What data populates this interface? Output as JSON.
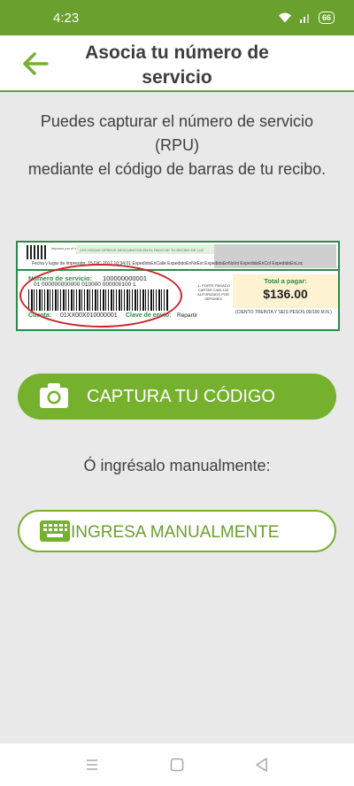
{
  "status_bar": {
    "time": "4:23",
    "battery": "66",
    "icons": [
      "wifi-icon",
      "signal-icon",
      "battery-icon"
    ]
  },
  "header": {
    "title": "Asocia tu número de servicio",
    "back_icon": "arrow-left-icon"
  },
  "instruction": {
    "line1": "Puedes capturar el número de servicio (RPU)",
    "line2": "mediante el código de barras de tu recibo."
  },
  "receipt": {
    "qr_text": "impreso por el sitio web",
    "banner": "CFE HOGAR OFRECE DESCUENTOS EN EL PAGO DE TU RECIBO DE LUZ",
    "fecha": "Fecha y lugar de impresión: 15 DIC 2017 10:34:01 ExpedidoEnCalle ExpedidoEnNoExt ExpedidoEnNoInt ExpedidoEnCol ExpedidoEnLoc",
    "numero_servicio_label": "Número de servicio:",
    "numero_servicio_value": "100000000001",
    "digits": "01 000000000000 010000 000000100 1",
    "cuenta_label": "Cuenta:",
    "cuenta_value": "01XX00X010000001",
    "clave_label": "Clave de envío:",
    "clave_value": "Repartir",
    "porte": "-1- PORTE PAGADO CARTAS C403-133 AUTORIZADO POR SEPOMEX",
    "total_label": "Total a pagar:",
    "total_amount": "$136.00",
    "total_words": "(CIENTO TREINTA Y SEIS PESOS 00/100 M.N.)"
  },
  "capture_button": {
    "label": "CAPTURA TU CÓDIGO",
    "icon": "camera-icon"
  },
  "manual_text": "Ó ingrésalo manualmente:",
  "manual_button": {
    "label": "INGRESA MANUALMENTE",
    "icon": "keyboard-icon"
  },
  "nav_bar": {
    "items": [
      "menu-icon",
      "home-icon",
      "back-icon"
    ]
  },
  "colors": {
    "brand_green": "#6aa02d",
    "button_green": "#76b12d",
    "receipt_green": "#2d8a4a",
    "highlight_red": "#c8262c",
    "background": "#e9e9e9"
  }
}
